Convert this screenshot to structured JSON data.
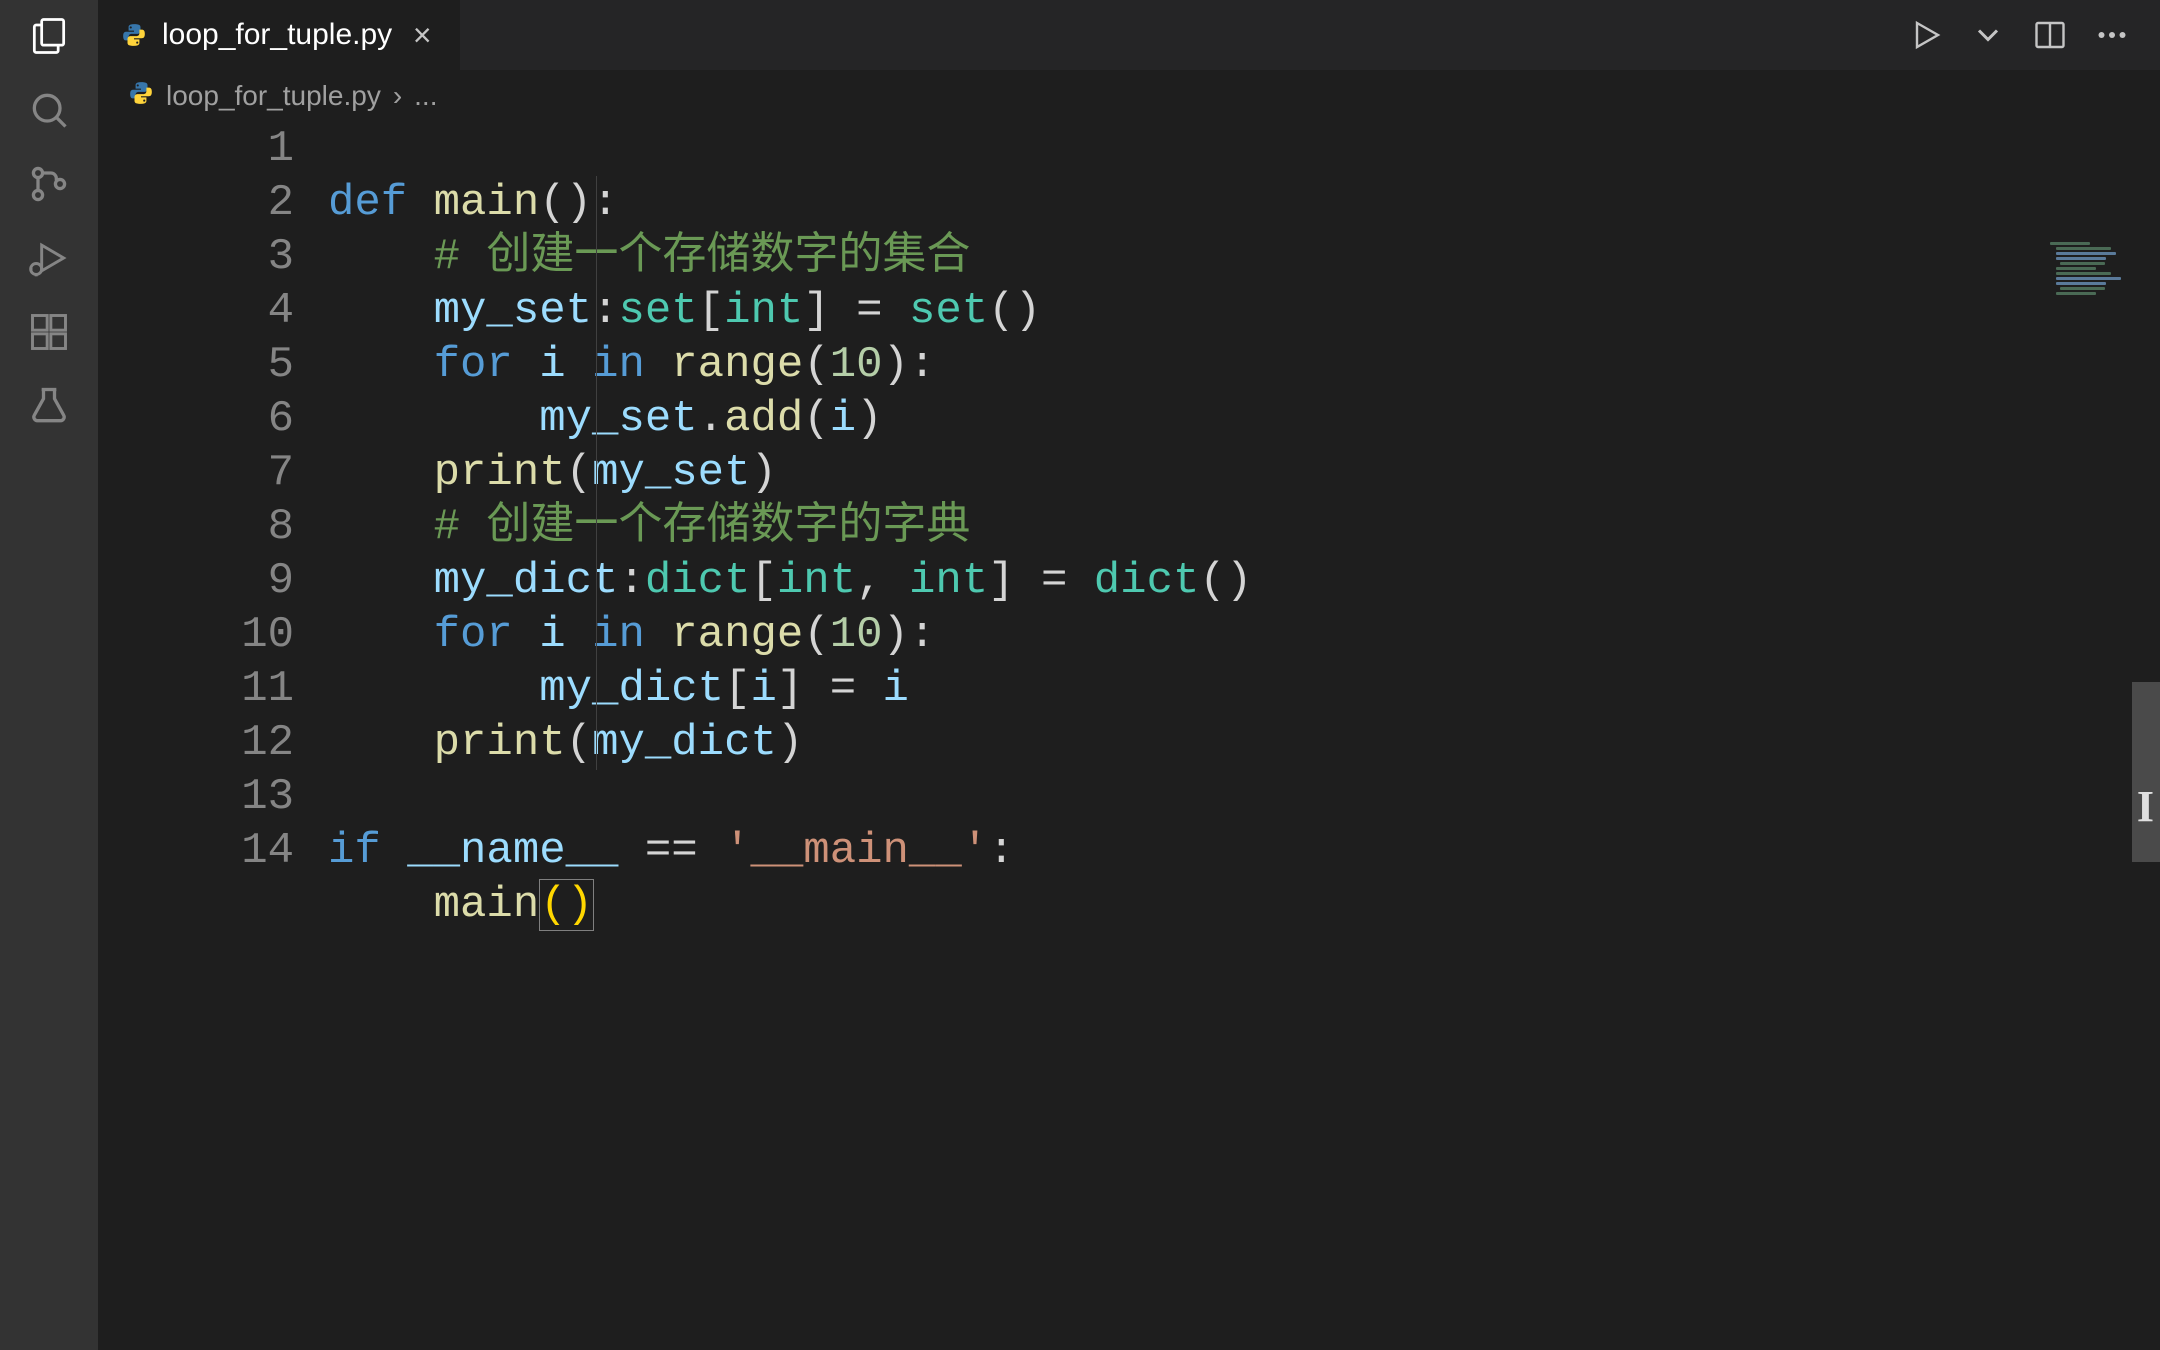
{
  "activity_bar": {
    "items": [
      {
        "name": "explorer-icon"
      },
      {
        "name": "search-icon"
      },
      {
        "name": "source-control-icon"
      },
      {
        "name": "run-debug-icon"
      },
      {
        "name": "extensions-icon"
      },
      {
        "name": "testing-icon"
      }
    ]
  },
  "tabs": {
    "active": {
      "label": "loop_for_tuple.py",
      "icon": "python"
    }
  },
  "breadcrumb": {
    "file": "loop_for_tuple.py",
    "sep": "›",
    "tail": "..."
  },
  "editor": {
    "line_numbers": [
      "1",
      "2",
      "3",
      "4",
      "5",
      "6",
      "7",
      "8",
      "9",
      "10",
      "11",
      "12",
      "13",
      "14"
    ],
    "code": {
      "l1": {
        "def": "def",
        "sp": " ",
        "main": "main",
        "op": "(",
        "cp": ")",
        "colon": ":"
      },
      "l2": {
        "indent": "    ",
        "comment": "# 创建一个存储数字的集合"
      },
      "l3": {
        "indent": "    ",
        "my_set": "my_set",
        "colon1": ":",
        "set_t": "set",
        "ob": "[",
        "int": "int",
        "cb": "]",
        "eq": " = ",
        "set_f": "set",
        "op": "(",
        "cp": ")"
      },
      "l4": {
        "indent": "    ",
        "for": "for",
        "sp1": " ",
        "i": "i",
        "sp2": " ",
        "in": "in",
        "sp3": " ",
        "range": "range",
        "op": "(",
        "n": "10",
        "cp": ")",
        "colon": ":"
      },
      "l5": {
        "indent": "        ",
        "my_set": "my_set",
        "dot": ".",
        "add": "add",
        "op": "(",
        "i": "i",
        "cp": ")"
      },
      "l6": {
        "indent": "    ",
        "print": "print",
        "op": "(",
        "my_set": "my_set",
        "cp": ")"
      },
      "l7": {
        "indent": "    ",
        "comment": "# 创建一个存储数字的字典"
      },
      "l8": {
        "indent": "    ",
        "my_dict": "my_dict",
        "colon1": ":",
        "dict_t": "dict",
        "ob": "[",
        "int1": "int",
        "comma": ", ",
        "int2": "int",
        "cb": "]",
        "eq": " = ",
        "dict_f": "dict",
        "op": "(",
        "cp": ")"
      },
      "l9": {
        "indent": "    ",
        "for": "for",
        "sp1": " ",
        "i": "i",
        "sp2": " ",
        "in": "in",
        "sp3": " ",
        "range": "range",
        "op": "(",
        "n": "10",
        "cp": ")",
        "colon": ":"
      },
      "l10": {
        "indent": "        ",
        "my_dict": "my_dict",
        "ob": "[",
        "i": "i",
        "cb": "]",
        "eq": " = ",
        "i2": "i"
      },
      "l11": {
        "indent": "    ",
        "print": "print",
        "op": "(",
        "my_dict": "my_dict",
        "cp": ")"
      },
      "l12": {
        "blank": " "
      },
      "l13": {
        "if": "if",
        "sp": " ",
        "name": "__name__",
        "eqeq": " == ",
        "str": "'__main__'",
        "colon": ":"
      },
      "l14": {
        "indent": "    ",
        "main": "main",
        "op": "(",
        "cp": ")"
      }
    }
  },
  "colors": {
    "bg": "#1e1e1e",
    "activity": "#333333",
    "keyword": "#569cd6",
    "function": "#dcdcaa",
    "comment": "#6a9955",
    "variable": "#9cdcfe",
    "type": "#4ec9b0",
    "number": "#b5cea8",
    "string": "#ce9178",
    "bracket_highlight": "#ffd700"
  }
}
